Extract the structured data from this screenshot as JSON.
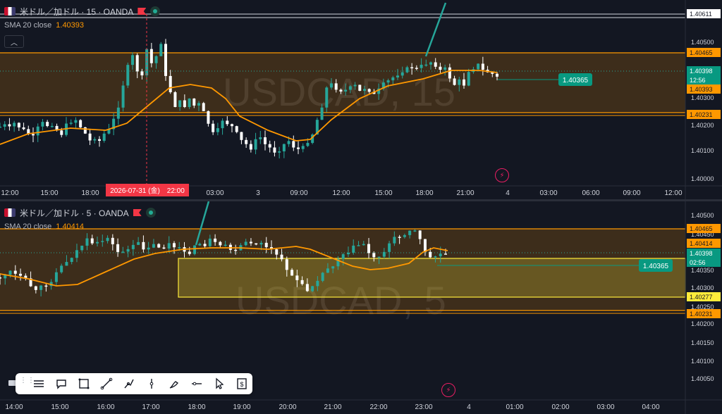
{
  "top_chart": {
    "flag_icon": "us-ca-flag",
    "symbol": "米ドル／加ドル · 15 · OANDA",
    "indicator_name": "SMA 20 close",
    "indicator_value": "1.40393",
    "watermark": "USDCAD, 15",
    "price_ticks": [
      "1.40500",
      "1.40400",
      "1.40300",
      "1.40200",
      "1.40100",
      "1.40000"
    ],
    "price_labels": {
      "high_line": "1.40611",
      "range_top": "1.40465",
      "last": "1.40398",
      "countdown": "12:56",
      "sma": "1.40393",
      "range_bottom": "1.40231"
    },
    "time_ticks": [
      "12:00",
      "15:00",
      "18:00",
      "03:00",
      "3",
      "09:00",
      "12:00",
      "15:00",
      "18:00",
      "21:00",
      "4",
      "03:00",
      "06:00",
      "09:00",
      "12:00"
    ],
    "crosshair_time": "2026-07-31 (金)　22:00",
    "order_label": "1.40365"
  },
  "bottom_chart": {
    "flag_icon": "us-ca-flag",
    "symbol": "米ドル／加ドル · 5 · OANDA",
    "indicator_name": "SMA 20 close",
    "indicator_value": "1.40414",
    "watermark": "USDCAD, 5",
    "price_ticks": [
      "1.40500",
      "1.40450",
      "1.40350",
      "1.40300",
      "1.40250",
      "1.40200",
      "1.40150",
      "1.40100",
      "1.40050"
    ],
    "price_labels": {
      "range_top": "1.40465",
      "sma": "1.40414",
      "last": "1.40398",
      "countdown": "02:56",
      "zone_bottom": "1.40277",
      "range_bottom": "1.40231"
    },
    "time_ticks": [
      "14:00",
      "15:00",
      "16:00",
      "17:00",
      "18:00",
      "19:00",
      "20:00",
      "21:00",
      "22:00",
      "23:00",
      "4",
      "01:00",
      "02:00",
      "03:00",
      "04:00"
    ],
    "order_label": "1.40365"
  },
  "toolbar": {
    "tools": [
      "lines-icon",
      "comment-icon",
      "rectangle-icon",
      "trendline-icon",
      "path-icon",
      "vertical-line-icon",
      "brush-icon",
      "horizontal-ray-icon",
      "cursor-icon",
      "price-label-icon"
    ]
  },
  "colors": {
    "background": "#131722",
    "bull": "#26a69a",
    "bear": "#ffffff",
    "sma": "#ff9800",
    "zone": "#ffeb3b",
    "order": "#089981",
    "crosshair": "#f23645"
  }
}
